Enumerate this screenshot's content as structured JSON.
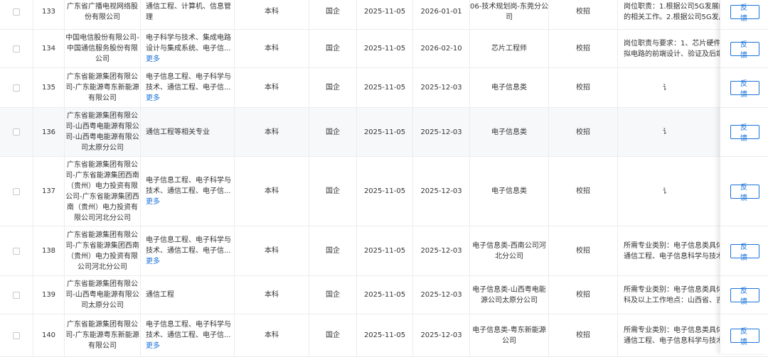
{
  "rows": [
    {
      "no": "133",
      "company": "广东省广播电视网络股份有限公司",
      "majors": "通信工程、计算机、信息管理",
      "more": "",
      "education": "本科",
      "nature": "国企",
      "publish": "2025-11-05",
      "deadline": "2026-01-01",
      "position": "06-技术规划岗-东莞分公司",
      "type": "校招",
      "desc1": "岗位职责：1.根据公司5G发展的相",
      "desc2": "的相关工作。2.根据公司5G发展建",
      "stub": "",
      "feedback": "反 馈"
    },
    {
      "no": "134",
      "company": "中国电信股份有限公司-中国通信服务股份有限公司",
      "majors": "电子科学与技术、集成电路设计与集成系统、电子信...",
      "more": "更多",
      "education": "本科",
      "nature": "国企",
      "publish": "2025-11-05",
      "deadline": "2026-02-10",
      "position": "芯片工程师",
      "type": "校招",
      "desc1": "岗位职责与要求：1、芯片硬件设",
      "desc2": "拟电路的前端设计、验证及后端物",
      "stub": "",
      "feedback": "反 馈"
    },
    {
      "no": "135",
      "company": "广东省能源集团有限公司-广东能源粤东新能源有限公司",
      "majors": "电子信息工程、电子科学与技术、通信工程、电子信...",
      "more": "更多",
      "education": "本科",
      "nature": "国企",
      "publish": "2025-11-05",
      "deadline": "2025-12-03",
      "position": "电子信息类",
      "type": "校招",
      "desc1": "",
      "desc2": "",
      "stub": "讠",
      "feedback": "反 馈"
    },
    {
      "no": "136",
      "company": "广东省能源集团有限公司-山西粤电能源有限公司-山西粤电能源有限公司太原分公司",
      "majors": "通信工程等相关专业",
      "more": "",
      "education": "本科",
      "nature": "国企",
      "publish": "2025-11-05",
      "deadline": "2025-12-03",
      "position": "电子信息类",
      "type": "校招",
      "desc1": "",
      "desc2": "",
      "stub": "讠",
      "feedback": "反 馈"
    },
    {
      "no": "137",
      "company": "广东省能源集团有限公司-广东省能源集团西南（贵州）电力投资有限公司-广东省能源集团西南（贵州）电力投资有限公司河北分公司",
      "majors": "电子信息工程、电子科学与技术、通信工程、电子信...",
      "more": "更多",
      "education": "本科",
      "nature": "国企",
      "publish": "2025-11-05",
      "deadline": "2025-12-03",
      "position": "电子信息类",
      "type": "校招",
      "desc1": "",
      "desc2": "",
      "stub": "讠",
      "feedback": "反 馈"
    },
    {
      "no": "138",
      "company": "广东省能源集团有限公司-广东省能源集团西南（贵州）电力投资有限公司河北分公司",
      "majors": "电子信息工程、电子科学与技术、通信工程、电子信...",
      "more": "更多",
      "education": "本科",
      "nature": "国企",
      "publish": "2025-11-05",
      "deadline": "2025-12-03",
      "position": "电子信息类-西南公司河北分公司",
      "type": "校招",
      "desc1": "所需专业类别：电子信息类具体专",
      "desc2": "通信工程、电子信息科学与技术、",
      "stub": "",
      "feedback": "反 馈"
    },
    {
      "no": "139",
      "company": "广东省能源集团有限公司-山西粤电能源有限公司太原分公司",
      "majors": "通信工程",
      "more": "",
      "education": "本科",
      "nature": "国企",
      "publish": "2025-11-05",
      "deadline": "2025-12-03",
      "position": "电子信息类-山西粤电能源公司太原分公司",
      "type": "校招",
      "desc1": "所需专业类别：电子信息类具体专",
      "desc2": "科及以上工作地点：山西省、吉林",
      "stub": "",
      "feedback": "反 馈"
    },
    {
      "no": "140",
      "company": "广东省能源集团有限公司-广东能源粤东新能源有限公司",
      "majors": "电子信息工程、电子科学与技术、通信工程、电子信...",
      "more": "更多",
      "education": "本科",
      "nature": "国企",
      "publish": "2025-11-05",
      "deadline": "2025-12-03",
      "position": "电子信息类-粤东新能源公司",
      "type": "校招",
      "desc1": "所需专业类别：电子信息类具体专",
      "desc2": "通信工程、电子信息科学与技术、",
      "stub": "",
      "feedback": "反 馈"
    }
  ]
}
